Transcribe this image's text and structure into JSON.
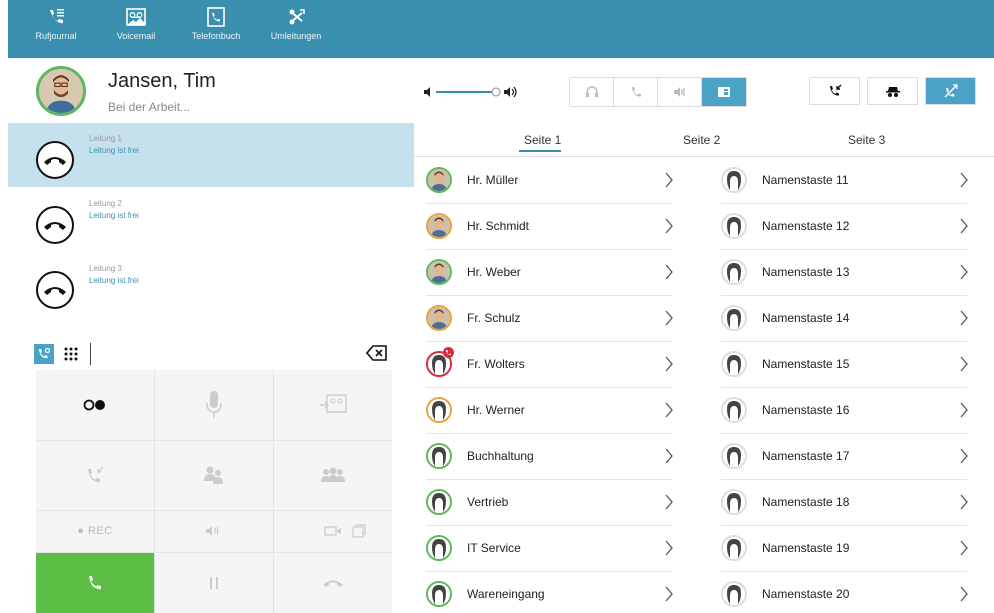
{
  "topnav": [
    {
      "label": "Rufjournal",
      "icon": "call-journal-icon"
    },
    {
      "label": "Voicemail",
      "icon": "voicemail-icon"
    },
    {
      "label": "Telefonbuch",
      "icon": "phonebook-icon"
    },
    {
      "label": "Umleitungen",
      "icon": "call-forward-icon"
    }
  ],
  "user": {
    "name": "Jansen, Tim",
    "status": "Bei der Arbeit..."
  },
  "lines": [
    {
      "name": "Leitung 1",
      "status": "Leitung ist frei"
    },
    {
      "name": "Leitung 2",
      "status": "Leitung ist frei"
    },
    {
      "name": "Leitung 3",
      "status": "Leitung ist frei"
    }
  ],
  "dial": {
    "value": ""
  },
  "keypad": {
    "rec_label": "REC"
  },
  "tabs": [
    "Seite 1",
    "Seite 2",
    "Seite 3"
  ],
  "contacts_left": [
    {
      "name": "Hr. Müller",
      "ring": "#5cb85c",
      "photo": true
    },
    {
      "name": "Hr. Schmidt",
      "ring": "#e8a33b",
      "photo": true
    },
    {
      "name": "Hr. Weber",
      "ring": "#5cb85c",
      "photo": true
    },
    {
      "name": "Fr. Schulz",
      "ring": "#e8a33b",
      "photo": true
    },
    {
      "name": "Fr. Wolters",
      "ring": "#d9283a",
      "photo": false
    },
    {
      "name": "Hr. Werner",
      "ring": "#e8a33b",
      "photo": false
    },
    {
      "name": "Buchhaltung",
      "ring": "#5cb85c",
      "photo": false
    },
    {
      "name": "Vertrieb",
      "ring": "#5cb85c",
      "photo": false
    },
    {
      "name": "IT Service",
      "ring": "#5cb85c",
      "photo": false
    },
    {
      "name": "Wareneingang",
      "ring": "#5cb85c",
      "photo": false
    }
  ],
  "contacts_right": [
    {
      "name": "Namenstaste 11"
    },
    {
      "name": "Namenstaste 12"
    },
    {
      "name": "Namenstaste 13"
    },
    {
      "name": "Namenstaste 14"
    },
    {
      "name": "Namenstaste 15"
    },
    {
      "name": "Namenstaste 16"
    },
    {
      "name": "Namenstaste 17"
    },
    {
      "name": "Namenstaste 18"
    },
    {
      "name": "Namenstaste 19"
    },
    {
      "name": "Namenstaste 20"
    }
  ],
  "colors": {
    "accent": "#3b8fae",
    "active": "#4aa3c6",
    "call": "#5cbd45",
    "line_active": "#c6e1ee"
  }
}
